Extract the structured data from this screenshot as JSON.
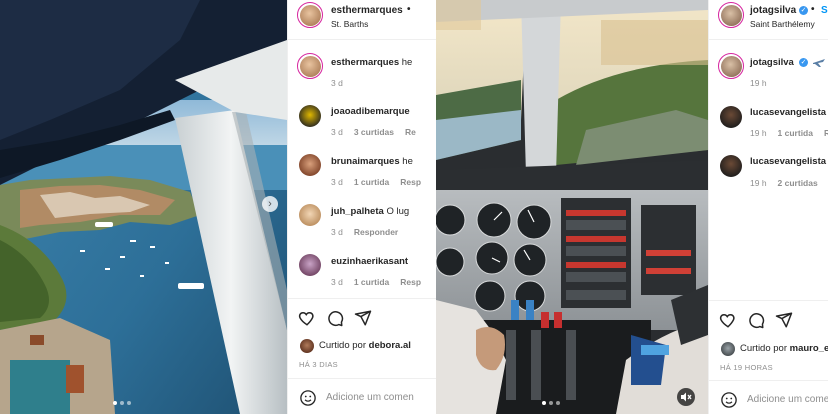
{
  "colors": {
    "link_blue": "#0095f6",
    "verified_blue": "#3897f0",
    "meta_gray": "#8e8e8e"
  },
  "post1": {
    "author": {
      "username": "esthermarques",
      "location": "St. Barths",
      "separator": "•"
    },
    "comments": [
      {
        "username": "esthermarques",
        "text": "he",
        "age": "3 d",
        "likes": "",
        "reply": ""
      },
      {
        "username": "joaoadibemarque",
        "text": "",
        "age": "3 d",
        "likes": "3 curtidas",
        "reply": "Re"
      },
      {
        "username": "brunaimarques",
        "text": "he",
        "age": "3 d",
        "likes": "1 curtida",
        "reply": "Resp"
      },
      {
        "username": "juh_palheta",
        "text": "O lug",
        "age": "3 d",
        "likes": "",
        "reply": "Responder"
      },
      {
        "username": "euzinhaerikasant",
        "text": "",
        "age": "3 d",
        "likes": "1 curtida",
        "reply": "Resp"
      }
    ],
    "liked_by_prefix": "Curtido por",
    "liked_by_user": "debora.al",
    "time_ago": "HÁ 3 DIAS",
    "add_comment_placeholder": "Adicione um comen",
    "icons": [
      "heart-icon",
      "comment-icon",
      "share-icon",
      "emoji-icon",
      "chevron-right-icon"
    ]
  },
  "post2": {
    "author": {
      "username": "jotagsilva",
      "location": "Saint Barthélemy",
      "separator": "•",
      "follow": "S"
    },
    "comments": [
      {
        "username": "jotagsilva",
        "text": "",
        "age": "19 h",
        "likes": "",
        "reply": ""
      },
      {
        "username": "lucasevangelista",
        "text": "",
        "age": "19 h",
        "likes": "1 curtida",
        "reply": "R"
      },
      {
        "username": "lucasevangelista",
        "text": "",
        "age": "19 h",
        "likes": "2 curtidas",
        "reply": ""
      }
    ],
    "liked_by_prefix": "Curtido por",
    "liked_by_user": "mauro_e",
    "time_ago": "HÁ 19 HORAS",
    "add_comment_placeholder": "Adicione um come",
    "icons": [
      "heart-icon",
      "comment-icon",
      "share-icon",
      "emoji-icon",
      "mute-icon"
    ]
  }
}
